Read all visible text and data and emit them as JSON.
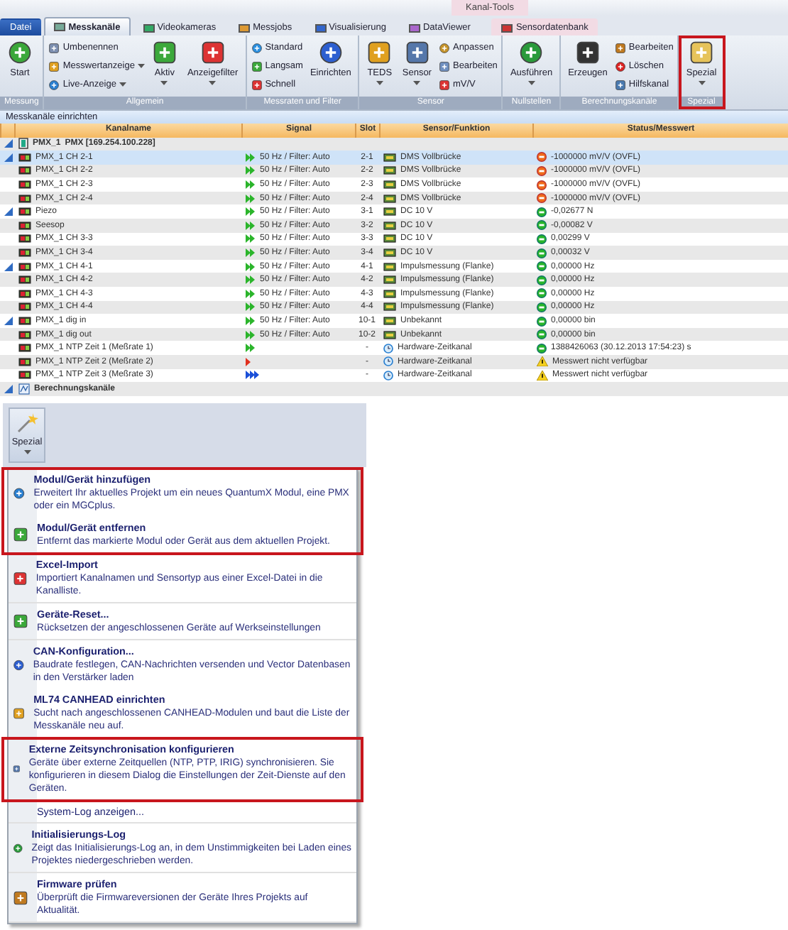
{
  "title_bar": {
    "context_tab": "Kanal-Tools"
  },
  "tabs": [
    {
      "label": "Datei",
      "selected": false,
      "kind": "file"
    },
    {
      "label": "Messkanäle",
      "selected": true,
      "kind": "tab"
    },
    {
      "label": "Videokameras",
      "selected": false,
      "kind": "tab"
    },
    {
      "label": "Messjobs",
      "selected": false,
      "kind": "tab"
    },
    {
      "label": "Visualisierung",
      "selected": false,
      "kind": "tab"
    },
    {
      "label": "DataViewer",
      "selected": false,
      "kind": "tab"
    },
    {
      "label": "Sensordatenbank",
      "selected": false,
      "kind": "context"
    }
  ],
  "ribbon": [
    {
      "label": "Messung",
      "highlighted": false,
      "items": [
        {
          "label": "Start",
          "kind": "large",
          "dropdown": false
        }
      ]
    },
    {
      "label": "Allgemein",
      "highlighted": false,
      "items": [
        {
          "label": "Umbenennen",
          "kind": "small",
          "dropdown": false
        },
        {
          "label": "Messwertanzeige",
          "kind": "small",
          "dropdown": true
        },
        {
          "label": "Live-Anzeige",
          "kind": "small",
          "dropdown": true
        },
        {
          "label": "Aktiv",
          "kind": "large",
          "dropdown": true
        },
        {
          "label": "Anzeigefilter",
          "kind": "large",
          "dropdown": true
        }
      ]
    },
    {
      "label": "Messraten und Filter",
      "highlighted": false,
      "items": [
        {
          "label": "Standard",
          "kind": "small",
          "dropdown": false
        },
        {
          "label": "Langsam",
          "kind": "small",
          "dropdown": false
        },
        {
          "label": "Schnell",
          "kind": "small",
          "dropdown": false
        },
        {
          "label": "Einrichten",
          "kind": "large",
          "dropdown": false
        }
      ]
    },
    {
      "label": "Sensor",
      "highlighted": false,
      "items": [
        {
          "label": "TEDS",
          "kind": "large",
          "dropdown": true
        },
        {
          "label": "Sensor",
          "kind": "large",
          "dropdown": true
        },
        {
          "label": "Anpassen",
          "kind": "small",
          "dropdown": false
        },
        {
          "label": "Bearbeiten",
          "kind": "small",
          "dropdown": false
        },
        {
          "label": "mV/V",
          "kind": "small",
          "dropdown": false
        }
      ]
    },
    {
      "label": "Nullstellen",
      "highlighted": false,
      "items": [
        {
          "label": "Ausführen",
          "kind": "large",
          "dropdown": true
        }
      ]
    },
    {
      "label": "Berechnungskanäle",
      "highlighted": false,
      "items": [
        {
          "label": "Erzeugen",
          "kind": "large",
          "dropdown": false
        },
        {
          "label": "Bearbeiten",
          "kind": "small",
          "dropdown": false
        },
        {
          "label": "Löschen",
          "kind": "small",
          "dropdown": false
        },
        {
          "label": "Hilfskanal",
          "kind": "small",
          "dropdown": false
        }
      ]
    },
    {
      "label": "Spezial",
      "highlighted": true,
      "items": [
        {
          "label": "Spezial",
          "kind": "large",
          "dropdown": true
        }
      ]
    }
  ],
  "section_title": "Messkanäle einrichten",
  "table": {
    "columns": [
      "Kanalname",
      "Signal",
      "Slot",
      "Sensor/Funktion",
      "Status/Messwert"
    ],
    "rows": [
      {
        "kind": "device",
        "name": "PMX_1",
        "detail": "PMX [169.254.100.228]",
        "expander": true,
        "selected": false
      },
      {
        "kind": "channel",
        "name": "PMX_1 CH 2-1",
        "signal": {
          "kind": "standard",
          "text": "50 Hz / Filter: Auto"
        },
        "slot": "2-1",
        "sensor": {
          "kind": "module",
          "text": "DMS Vollbrücke"
        },
        "status": {
          "kind": "error",
          "text": "-1000000 mV/V (OVFL)"
        },
        "expander": true,
        "selected": true
      },
      {
        "kind": "channel",
        "name": "PMX_1 CH 2-2",
        "signal": {
          "kind": "standard",
          "text": "50 Hz / Filter: Auto"
        },
        "slot": "2-2",
        "sensor": {
          "kind": "module",
          "text": "DMS Vollbrücke"
        },
        "status": {
          "kind": "error",
          "text": "-1000000 mV/V (OVFL)"
        },
        "expander": false,
        "selected": false
      },
      {
        "kind": "channel",
        "name": "PMX_1 CH 2-3",
        "signal": {
          "kind": "standard",
          "text": "50 Hz / Filter: Auto"
        },
        "slot": "2-3",
        "sensor": {
          "kind": "module",
          "text": "DMS Vollbrücke"
        },
        "status": {
          "kind": "error",
          "text": "-1000000 mV/V (OVFL)"
        },
        "expander": false,
        "selected": false
      },
      {
        "kind": "channel",
        "name": "PMX_1 CH 2-4",
        "signal": {
          "kind": "standard",
          "text": "50 Hz / Filter: Auto"
        },
        "slot": "2-4",
        "sensor": {
          "kind": "module",
          "text": "DMS Vollbrücke"
        },
        "status": {
          "kind": "error",
          "text": "-1000000 mV/V (OVFL)"
        },
        "expander": false,
        "selected": false
      },
      {
        "kind": "channel",
        "name": "Piezo",
        "signal": {
          "kind": "standard",
          "text": "50 Hz / Filter: Auto"
        },
        "slot": "3-1",
        "sensor": {
          "kind": "module",
          "text": "DC 10 V"
        },
        "status": {
          "kind": "ok",
          "text": "-0,02677 N"
        },
        "expander": true,
        "selected": false
      },
      {
        "kind": "channel",
        "name": "Seesop",
        "signal": {
          "kind": "standard",
          "text": "50 Hz / Filter: Auto"
        },
        "slot": "3-2",
        "sensor": {
          "kind": "module",
          "text": "DC 10 V"
        },
        "status": {
          "kind": "ok",
          "text": "-0,00082 V"
        },
        "expander": false,
        "selected": false
      },
      {
        "kind": "channel",
        "name": "PMX_1 CH 3-3",
        "signal": {
          "kind": "standard",
          "text": "50 Hz / Filter: Auto"
        },
        "slot": "3-3",
        "sensor": {
          "kind": "module",
          "text": "DC 10 V"
        },
        "status": {
          "kind": "ok",
          "text": "0,00299 V"
        },
        "expander": false,
        "selected": false
      },
      {
        "kind": "channel",
        "name": "PMX_1 CH 3-4",
        "signal": {
          "kind": "standard",
          "text": "50 Hz / Filter: Auto"
        },
        "slot": "3-4",
        "sensor": {
          "kind": "module",
          "text": "DC 10 V"
        },
        "status": {
          "kind": "ok",
          "text": "0,00032 V"
        },
        "expander": false,
        "selected": false
      },
      {
        "kind": "channel",
        "name": "PMX_1 CH 4-1",
        "signal": {
          "kind": "standard",
          "text": "50 Hz / Filter: Auto"
        },
        "slot": "4-1",
        "sensor": {
          "kind": "module",
          "text": "Impulsmessung (Flanke)"
        },
        "status": {
          "kind": "ok",
          "text": "0,00000 Hz"
        },
        "expander": true,
        "selected": false
      },
      {
        "kind": "channel",
        "name": "PMX_1 CH 4-2",
        "signal": {
          "kind": "standard",
          "text": "50 Hz / Filter: Auto"
        },
        "slot": "4-2",
        "sensor": {
          "kind": "module",
          "text": "Impulsmessung (Flanke)"
        },
        "status": {
          "kind": "ok",
          "text": "0,00000 Hz"
        },
        "expander": false,
        "selected": false
      },
      {
        "kind": "channel",
        "name": "PMX_1 CH 4-3",
        "signal": {
          "kind": "standard",
          "text": "50 Hz / Filter: Auto"
        },
        "slot": "4-3",
        "sensor": {
          "kind": "module",
          "text": "Impulsmessung (Flanke)"
        },
        "status": {
          "kind": "ok",
          "text": "0,00000 Hz"
        },
        "expander": false,
        "selected": false
      },
      {
        "kind": "channel",
        "name": "PMX_1 CH 4-4",
        "signal": {
          "kind": "standard",
          "text": "50 Hz / Filter: Auto"
        },
        "slot": "4-4",
        "sensor": {
          "kind": "module",
          "text": "Impulsmessung (Flanke)"
        },
        "status": {
          "kind": "ok",
          "text": "0,00000 Hz"
        },
        "expander": false,
        "selected": false
      },
      {
        "kind": "channel",
        "name": "PMX_1 dig in",
        "signal": {
          "kind": "standard",
          "text": "50 Hz / Filter: Auto"
        },
        "slot": "10-1",
        "sensor": {
          "kind": "module",
          "text": "Unbekannt"
        },
        "status": {
          "kind": "ok",
          "text": "0,00000 bin"
        },
        "expander": true,
        "selected": false
      },
      {
        "kind": "channel",
        "name": "PMX_1 dig out",
        "signal": {
          "kind": "standard",
          "text": "50 Hz / Filter: Auto"
        },
        "slot": "10-2",
        "sensor": {
          "kind": "module",
          "text": "Unbekannt"
        },
        "status": {
          "kind": "ok",
          "text": "0,00000 bin"
        },
        "expander": false,
        "selected": false
      },
      {
        "kind": "channel",
        "name": "PMX_1 NTP Zeit 1 (Meßrate 1)",
        "signal": {
          "kind": "standard"
        },
        "slot": "-",
        "sensor": {
          "kind": "time",
          "text": "Hardware-Zeitkanal"
        },
        "status": {
          "kind": "ok",
          "text": "1388426063 (30.12.2013 17:54:23) s"
        },
        "expander": false,
        "selected": false
      },
      {
        "kind": "channel",
        "name": "PMX_1 NTP Zeit 2 (Meßrate 2)",
        "signal": {
          "kind": "slow"
        },
        "slot": "-",
        "sensor": {
          "kind": "time",
          "text": "Hardware-Zeitkanal"
        },
        "status": {
          "kind": "warning",
          "text": "Messwert nicht verfügbar"
        },
        "expander": false,
        "selected": false
      },
      {
        "kind": "channel",
        "name": "PMX_1 NTP Zeit 3 (Meßrate 3)",
        "signal": {
          "kind": "fast"
        },
        "slot": "-",
        "sensor": {
          "kind": "time",
          "text": "Hardware-Zeitkanal"
        },
        "status": {
          "kind": "warning",
          "text": "Messwert nicht verfügbar"
        },
        "expander": false,
        "selected": false
      },
      {
        "kind": "group",
        "name": "Berechnungskanäle",
        "expander": true,
        "selected": false
      }
    ]
  },
  "special_button": {
    "label": "Spezial"
  },
  "menu": {
    "sections": [
      {
        "highlighted": true,
        "items": [
          {
            "title": "Modul/Gerät hinzufügen",
            "description": "Erweitert Ihr aktuelles Projekt um ein neues QuantumX Modul, eine PMX oder ein MGCplus."
          },
          {
            "title": "Modul/Gerät entfernen",
            "description": "Entfernt das markierte Modul oder Gerät aus dem aktuellen Projekt."
          }
        ]
      },
      {
        "highlighted": false,
        "items": [
          {
            "title": "Excel-Import",
            "description": "Importiert Kanalnamen und Sensortyp aus einer Excel-Datei in die Kanalliste."
          }
        ]
      },
      {
        "highlighted": false,
        "items": [
          {
            "title": "Geräte-Reset...",
            "description": "Rücksetzen der angeschlossenen Geräte auf Werkseinstellungen"
          }
        ]
      },
      {
        "highlighted": false,
        "items": [
          {
            "title": "CAN-Konfiguration...",
            "description": "Baudrate festlegen, CAN-Nachrichten versenden und Vector Datenbasen in den Verstärker laden"
          },
          {
            "title": "ML74 CANHEAD einrichten",
            "description": "Sucht nach angeschlossenen CANHEAD-Modulen und baut die Liste der Messkanäle neu auf."
          }
        ]
      },
      {
        "highlighted": true,
        "items": [
          {
            "title": "Externe Zeitsynchronisation konfigurieren",
            "description": "Geräte über externe Zeitquellen (NTP, PTP, IRIG) synchronisieren. Sie konfigurieren in diesem Dialog die Einstellungen der Zeit-Dienste auf den Geräten."
          }
        ]
      },
      {
        "highlighted": false,
        "items": [
          {
            "title": "System-Log anzeigen..."
          }
        ]
      },
      {
        "highlighted": false,
        "items": [
          {
            "title": "Initialisierungs-Log",
            "description": "Zeigt das Initialisierungs-Log an, in dem Unstimmigkeiten bei Laden eines Projektes niedergeschrieben werden."
          }
        ]
      },
      {
        "highlighted": false,
        "items": [
          {
            "title": "Firmware prüfen",
            "description": "Überprüft die Firmwareversionen der Geräte Ihres Projekts auf Aktualität."
          }
        ]
      }
    ]
  }
}
